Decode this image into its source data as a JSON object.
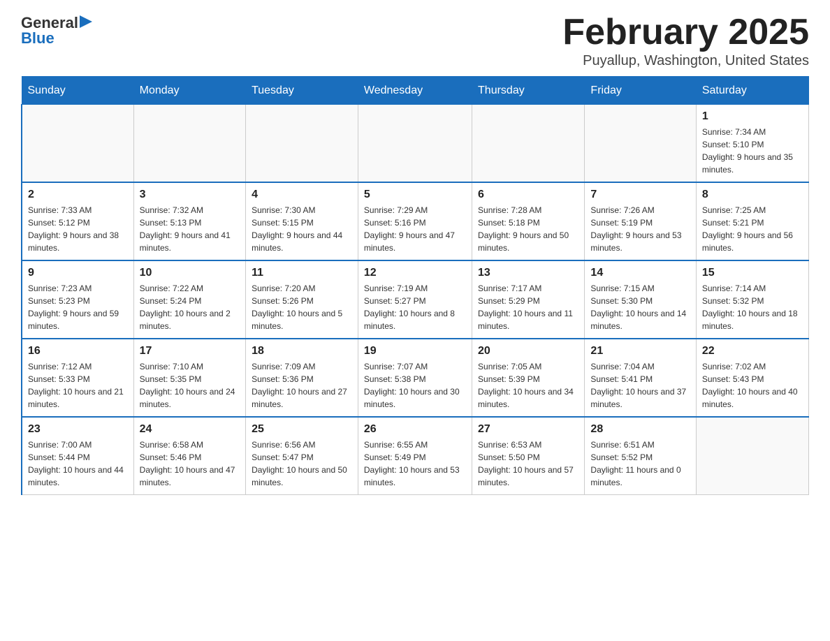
{
  "header": {
    "logo_general": "General",
    "logo_blue": "Blue",
    "month_title": "February 2025",
    "location": "Puyallup, Washington, United States"
  },
  "days_of_week": [
    "Sunday",
    "Monday",
    "Tuesday",
    "Wednesday",
    "Thursday",
    "Friday",
    "Saturday"
  ],
  "weeks": [
    {
      "days": [
        {
          "number": "",
          "info": ""
        },
        {
          "number": "",
          "info": ""
        },
        {
          "number": "",
          "info": ""
        },
        {
          "number": "",
          "info": ""
        },
        {
          "number": "",
          "info": ""
        },
        {
          "number": "",
          "info": ""
        },
        {
          "number": "1",
          "info": "Sunrise: 7:34 AM\nSunset: 5:10 PM\nDaylight: 9 hours and 35 minutes."
        }
      ]
    },
    {
      "days": [
        {
          "number": "2",
          "info": "Sunrise: 7:33 AM\nSunset: 5:12 PM\nDaylight: 9 hours and 38 minutes."
        },
        {
          "number": "3",
          "info": "Sunrise: 7:32 AM\nSunset: 5:13 PM\nDaylight: 9 hours and 41 minutes."
        },
        {
          "number": "4",
          "info": "Sunrise: 7:30 AM\nSunset: 5:15 PM\nDaylight: 9 hours and 44 minutes."
        },
        {
          "number": "5",
          "info": "Sunrise: 7:29 AM\nSunset: 5:16 PM\nDaylight: 9 hours and 47 minutes."
        },
        {
          "number": "6",
          "info": "Sunrise: 7:28 AM\nSunset: 5:18 PM\nDaylight: 9 hours and 50 minutes."
        },
        {
          "number": "7",
          "info": "Sunrise: 7:26 AM\nSunset: 5:19 PM\nDaylight: 9 hours and 53 minutes."
        },
        {
          "number": "8",
          "info": "Sunrise: 7:25 AM\nSunset: 5:21 PM\nDaylight: 9 hours and 56 minutes."
        }
      ]
    },
    {
      "days": [
        {
          "number": "9",
          "info": "Sunrise: 7:23 AM\nSunset: 5:23 PM\nDaylight: 9 hours and 59 minutes."
        },
        {
          "number": "10",
          "info": "Sunrise: 7:22 AM\nSunset: 5:24 PM\nDaylight: 10 hours and 2 minutes."
        },
        {
          "number": "11",
          "info": "Sunrise: 7:20 AM\nSunset: 5:26 PM\nDaylight: 10 hours and 5 minutes."
        },
        {
          "number": "12",
          "info": "Sunrise: 7:19 AM\nSunset: 5:27 PM\nDaylight: 10 hours and 8 minutes."
        },
        {
          "number": "13",
          "info": "Sunrise: 7:17 AM\nSunset: 5:29 PM\nDaylight: 10 hours and 11 minutes."
        },
        {
          "number": "14",
          "info": "Sunrise: 7:15 AM\nSunset: 5:30 PM\nDaylight: 10 hours and 14 minutes."
        },
        {
          "number": "15",
          "info": "Sunrise: 7:14 AM\nSunset: 5:32 PM\nDaylight: 10 hours and 18 minutes."
        }
      ]
    },
    {
      "days": [
        {
          "number": "16",
          "info": "Sunrise: 7:12 AM\nSunset: 5:33 PM\nDaylight: 10 hours and 21 minutes."
        },
        {
          "number": "17",
          "info": "Sunrise: 7:10 AM\nSunset: 5:35 PM\nDaylight: 10 hours and 24 minutes."
        },
        {
          "number": "18",
          "info": "Sunrise: 7:09 AM\nSunset: 5:36 PM\nDaylight: 10 hours and 27 minutes."
        },
        {
          "number": "19",
          "info": "Sunrise: 7:07 AM\nSunset: 5:38 PM\nDaylight: 10 hours and 30 minutes."
        },
        {
          "number": "20",
          "info": "Sunrise: 7:05 AM\nSunset: 5:39 PM\nDaylight: 10 hours and 34 minutes."
        },
        {
          "number": "21",
          "info": "Sunrise: 7:04 AM\nSunset: 5:41 PM\nDaylight: 10 hours and 37 minutes."
        },
        {
          "number": "22",
          "info": "Sunrise: 7:02 AM\nSunset: 5:43 PM\nDaylight: 10 hours and 40 minutes."
        }
      ]
    },
    {
      "days": [
        {
          "number": "23",
          "info": "Sunrise: 7:00 AM\nSunset: 5:44 PM\nDaylight: 10 hours and 44 minutes."
        },
        {
          "number": "24",
          "info": "Sunrise: 6:58 AM\nSunset: 5:46 PM\nDaylight: 10 hours and 47 minutes."
        },
        {
          "number": "25",
          "info": "Sunrise: 6:56 AM\nSunset: 5:47 PM\nDaylight: 10 hours and 50 minutes."
        },
        {
          "number": "26",
          "info": "Sunrise: 6:55 AM\nSunset: 5:49 PM\nDaylight: 10 hours and 53 minutes."
        },
        {
          "number": "27",
          "info": "Sunrise: 6:53 AM\nSunset: 5:50 PM\nDaylight: 10 hours and 57 minutes."
        },
        {
          "number": "28",
          "info": "Sunrise: 6:51 AM\nSunset: 5:52 PM\nDaylight: 11 hours and 0 minutes."
        },
        {
          "number": "",
          "info": ""
        }
      ]
    }
  ]
}
